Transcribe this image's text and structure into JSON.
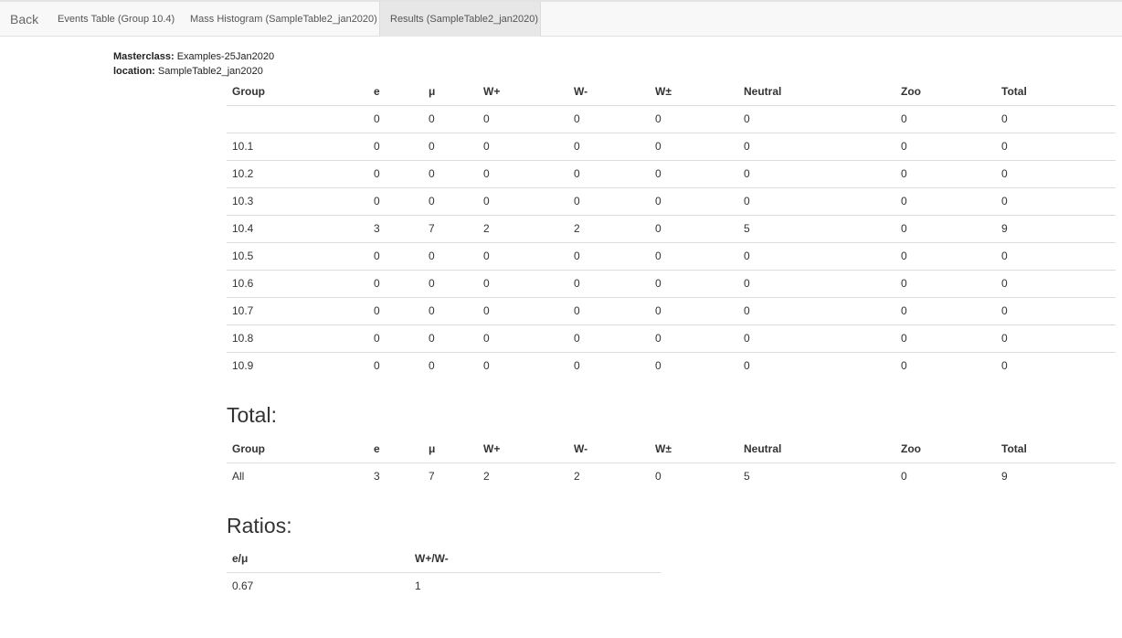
{
  "nav": {
    "back": "Back",
    "events_tab": "Events Table (Group 10.4)",
    "mass_tab": "Mass Histogram (SampleTable2_jan2020)",
    "results_tab": "Results (SampleTable2_jan2020)"
  },
  "info": {
    "masterclass_label": "Masterclass:",
    "masterclass_value": "Examples-25Jan2020",
    "location_label": "location:",
    "location_value": "SampleTable2_jan2020"
  },
  "columns": [
    "Group",
    "e",
    "μ",
    "W+",
    "W-",
    "W±",
    "Neutral",
    "Zoo",
    "Total"
  ],
  "results_rows": [
    [
      "",
      "0",
      "0",
      "0",
      "0",
      "0",
      "0",
      "0",
      "0"
    ],
    [
      "10.1",
      "0",
      "0",
      "0",
      "0",
      "0",
      "0",
      "0",
      "0"
    ],
    [
      "10.2",
      "0",
      "0",
      "0",
      "0",
      "0",
      "0",
      "0",
      "0"
    ],
    [
      "10.3",
      "0",
      "0",
      "0",
      "0",
      "0",
      "0",
      "0",
      "0"
    ],
    [
      "10.4",
      "3",
      "7",
      "2",
      "2",
      "0",
      "5",
      "0",
      "9"
    ],
    [
      "10.5",
      "0",
      "0",
      "0",
      "0",
      "0",
      "0",
      "0",
      "0"
    ],
    [
      "10.6",
      "0",
      "0",
      "0",
      "0",
      "0",
      "0",
      "0",
      "0"
    ],
    [
      "10.7",
      "0",
      "0",
      "0",
      "0",
      "0",
      "0",
      "0",
      "0"
    ],
    [
      "10.8",
      "0",
      "0",
      "0",
      "0",
      "0",
      "0",
      "0",
      "0"
    ],
    [
      "10.9",
      "0",
      "0",
      "0",
      "0",
      "0",
      "0",
      "0",
      "0"
    ]
  ],
  "total": {
    "heading": "Total:",
    "row": [
      "All",
      "3",
      "7",
      "2",
      "2",
      "0",
      "5",
      "0",
      "9"
    ]
  },
  "ratios": {
    "heading": "Ratios:",
    "columns": [
      "e/μ",
      "W+/W-"
    ],
    "row": [
      "0.67",
      "1"
    ]
  }
}
